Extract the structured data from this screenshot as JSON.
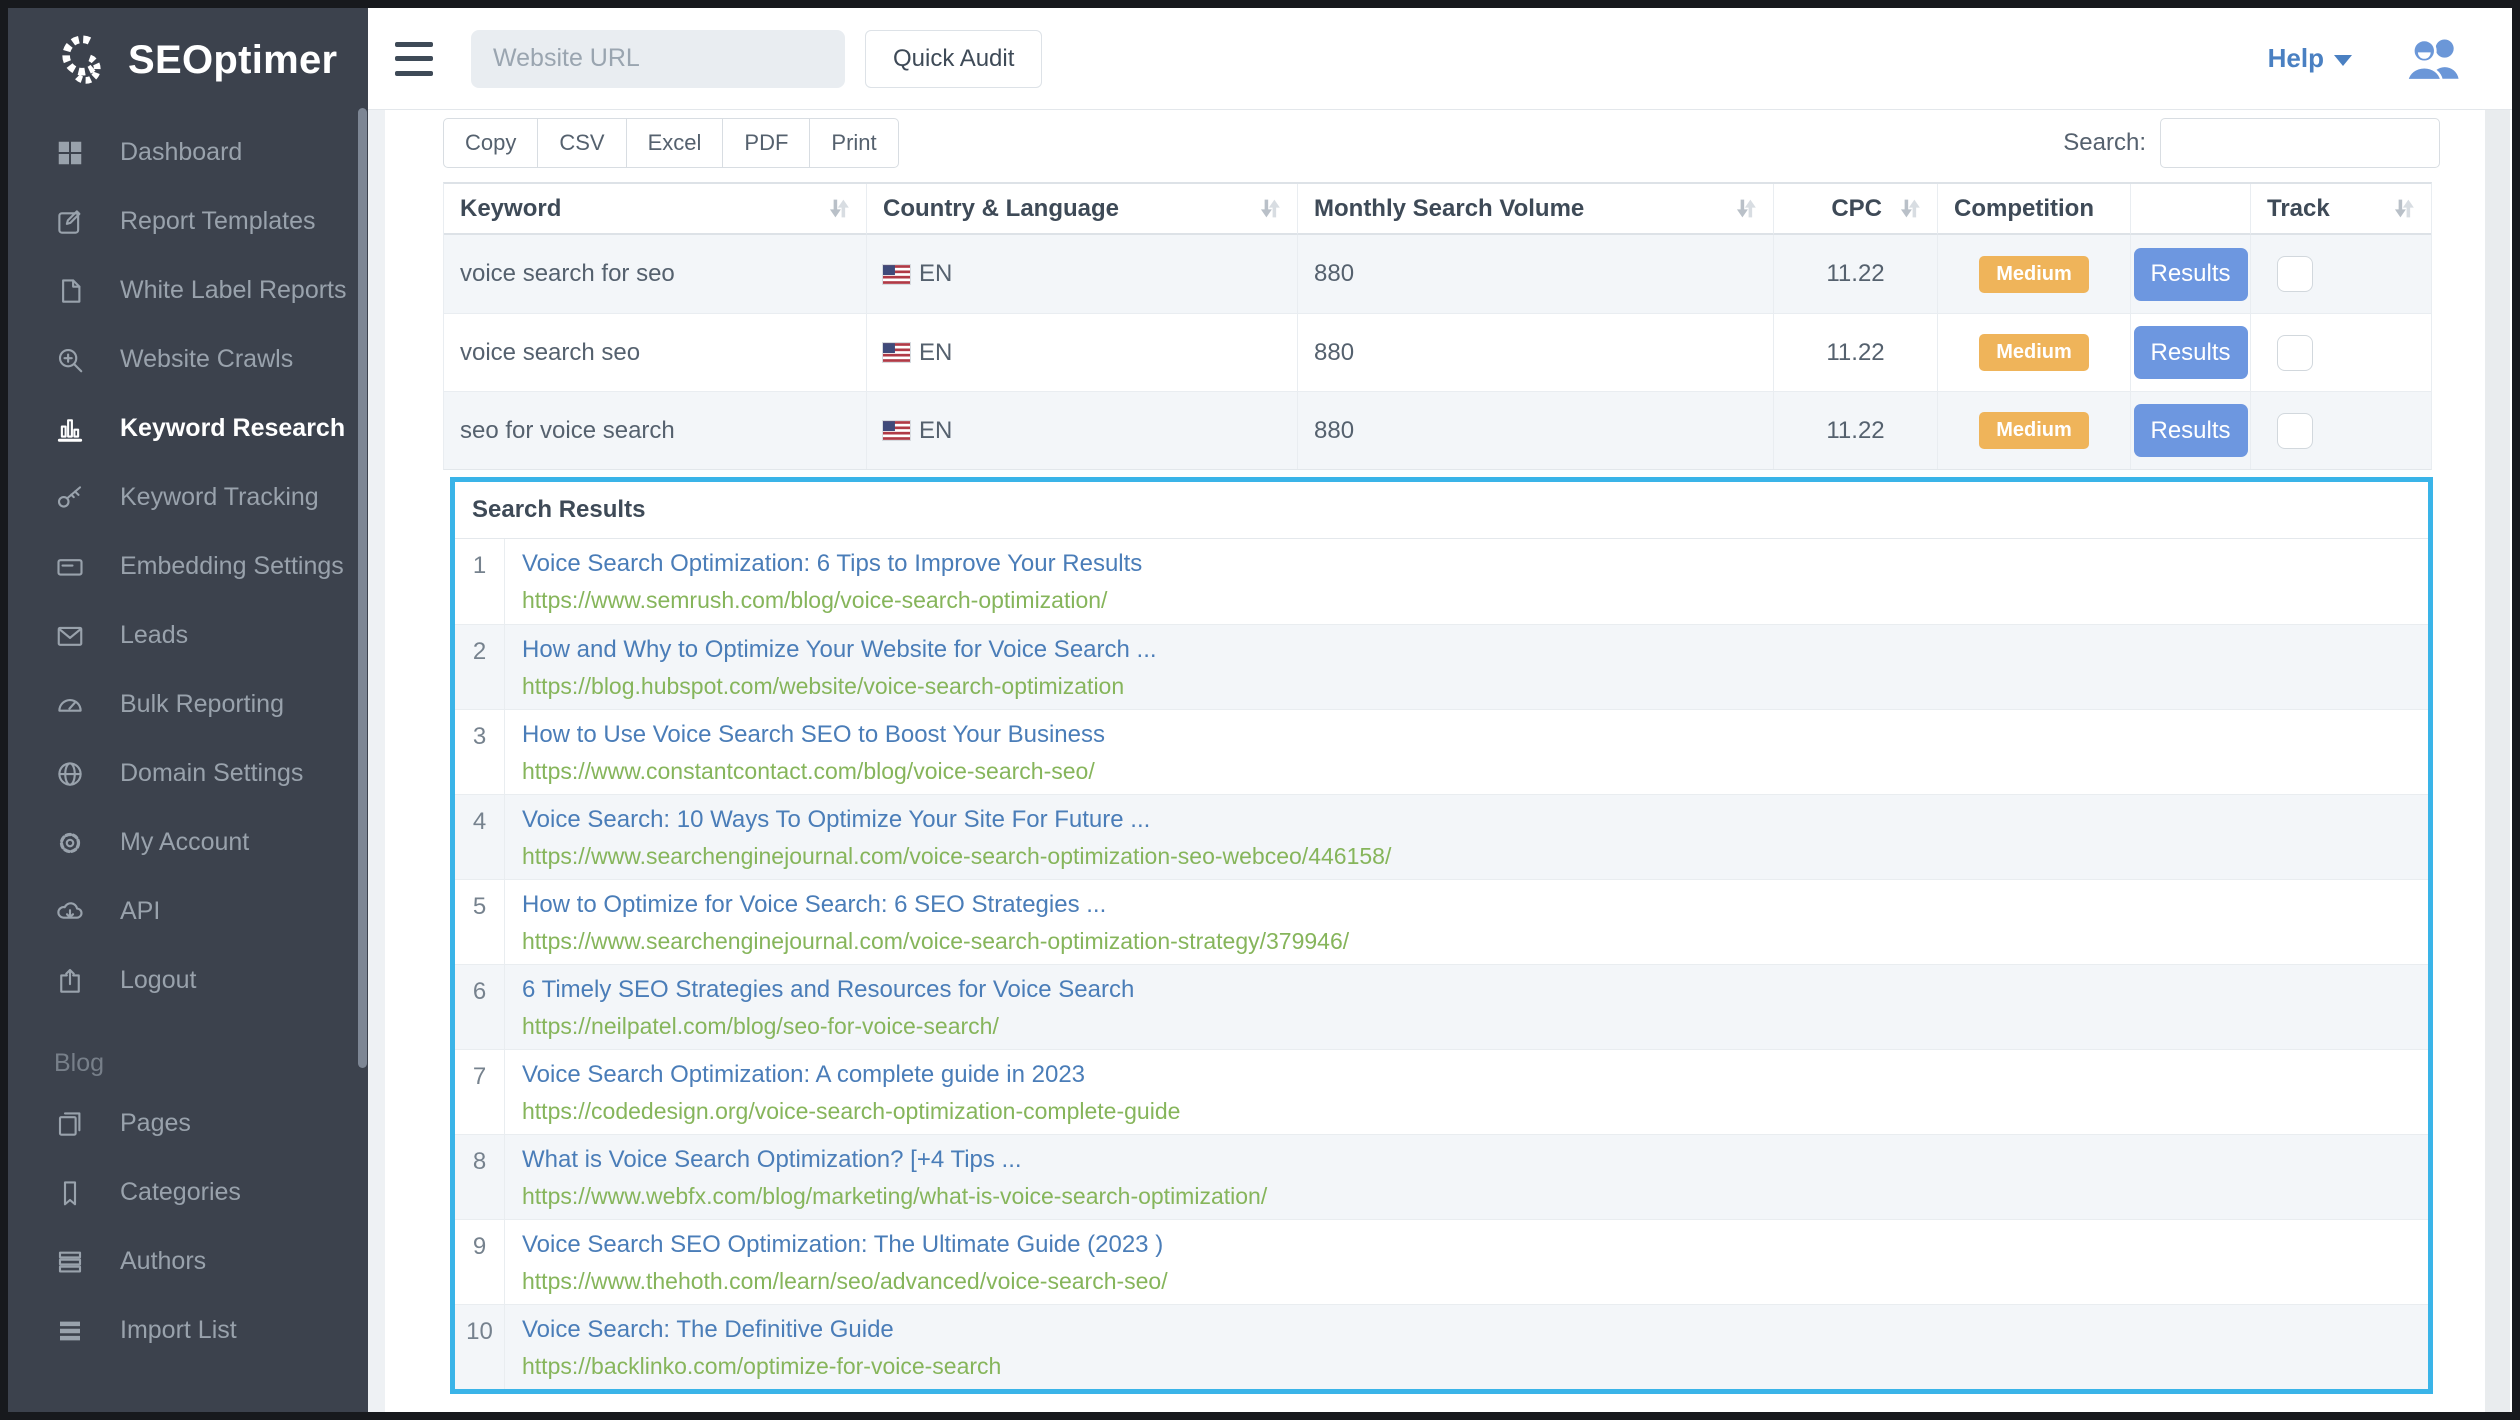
{
  "brand": {
    "name": "SEOptimer"
  },
  "topbar": {
    "url_placeholder": "Website URL",
    "quick_audit_label": "Quick Audit",
    "help_label": "Help"
  },
  "sidebar": {
    "items": [
      {
        "icon": "dashboard",
        "label": "Dashboard"
      },
      {
        "icon": "report-templates",
        "label": "Report Templates"
      },
      {
        "icon": "white-label-reports",
        "label": "White Label Reports"
      },
      {
        "icon": "website-crawls",
        "label": "Website Crawls"
      },
      {
        "icon": "keyword-research",
        "label": "Keyword Research",
        "active": true
      },
      {
        "icon": "keyword-tracking",
        "label": "Keyword Tracking"
      },
      {
        "icon": "embedding-settings",
        "label": "Embedding Settings"
      },
      {
        "icon": "leads",
        "label": "Leads"
      },
      {
        "icon": "bulk-reporting",
        "label": "Bulk Reporting"
      },
      {
        "icon": "domain-settings",
        "label": "Domain Settings"
      },
      {
        "icon": "my-account",
        "label": "My Account"
      },
      {
        "icon": "api",
        "label": "API"
      },
      {
        "icon": "logout",
        "label": "Logout"
      }
    ],
    "section_label": "Blog",
    "blog_items": [
      {
        "icon": "pages",
        "label": "Pages"
      },
      {
        "icon": "categories",
        "label": "Categories"
      },
      {
        "icon": "authors",
        "label": "Authors"
      },
      {
        "icon": "import-list",
        "label": "Import List"
      }
    ]
  },
  "toolbar": {
    "export_buttons": [
      "Copy",
      "CSV",
      "Excel",
      "PDF",
      "Print"
    ],
    "search_label": "Search:",
    "search_value": ""
  },
  "keyword_table": {
    "columns": [
      {
        "label": "Keyword",
        "sortable": true
      },
      {
        "label": "Country & Language",
        "sortable": true
      },
      {
        "label": "Monthly Search Volume",
        "sortable": true
      },
      {
        "label": "CPC",
        "sortable": true,
        "align": "end"
      },
      {
        "label": "Competition",
        "sortable": false
      },
      {
        "label": "",
        "sortable": false
      },
      {
        "label": "Track",
        "sortable": true
      }
    ],
    "rows": [
      {
        "keyword": "voice search for seo",
        "language": "EN",
        "volume": "880",
        "cpc": "11.22",
        "competition": "Medium",
        "action": "Results",
        "tracked": false
      },
      {
        "keyword": "voice search seo",
        "language": "EN",
        "volume": "880",
        "cpc": "11.22",
        "competition": "Medium",
        "action": "Results",
        "tracked": false
      },
      {
        "keyword": "seo for voice search",
        "language": "EN",
        "volume": "880",
        "cpc": "11.22",
        "competition": "Medium",
        "action": "Results",
        "tracked": false
      }
    ]
  },
  "search_results": {
    "title": "Search Results",
    "items": [
      {
        "rank": "1",
        "title": "Voice Search Optimization: 6 Tips to Improve Your Results",
        "url": "https://www.semrush.com/blog/voice-search-optimization/"
      },
      {
        "rank": "2",
        "title": "How and Why to Optimize Your Website for Voice Search ...",
        "url": "https://blog.hubspot.com/website/voice-search-optimization"
      },
      {
        "rank": "3",
        "title": "How to Use Voice Search SEO to Boost Your Business",
        "url": "https://www.constantcontact.com/blog/voice-search-seo/"
      },
      {
        "rank": "4",
        "title": "Voice Search: 10 Ways To Optimize Your Site For Future ...",
        "url": "https://www.searchenginejournal.com/voice-search-optimization-seo-webceo/446158/"
      },
      {
        "rank": "5",
        "title": "How to Optimize for Voice Search: 6 SEO Strategies ...",
        "url": "https://www.searchenginejournal.com/voice-search-optimization-strategy/379946/"
      },
      {
        "rank": "6",
        "title": "6 Timely SEO Strategies and Resources for Voice Search",
        "url": "https://neilpatel.com/blog/seo-for-voice-search/"
      },
      {
        "rank": "7",
        "title": "Voice Search Optimization: A complete guide in 2023",
        "url": "https://codedesign.org/voice-search-optimization-complete-guide"
      },
      {
        "rank": "8",
        "title": "What is Voice Search Optimization? [+4 Tips ...",
        "url": "https://www.webfx.com/blog/marketing/what-is-voice-search-optimization/"
      },
      {
        "rank": "9",
        "title": "Voice Search SEO Optimization: The Ultimate Guide (2023 )",
        "url": "https://www.thehoth.com/learn/seo/advanced/voice-search-seo/"
      },
      {
        "rank": "10",
        "title": "Voice Search: The Definitive Guide",
        "url": "https://backlinko.com/optimize-for-voice-search"
      }
    ]
  },
  "colors": {
    "sidebar_bg": "#3c424d",
    "accent_cyan": "#3ab4e8",
    "competition_medium_badge": "#efb45a",
    "results_button_blue": "#6d97e0",
    "link_blue": "#4a7db8",
    "url_green": "#86b55b",
    "help_blue": "#4a80c2",
    "striped_row": "#f3f6f9"
  }
}
